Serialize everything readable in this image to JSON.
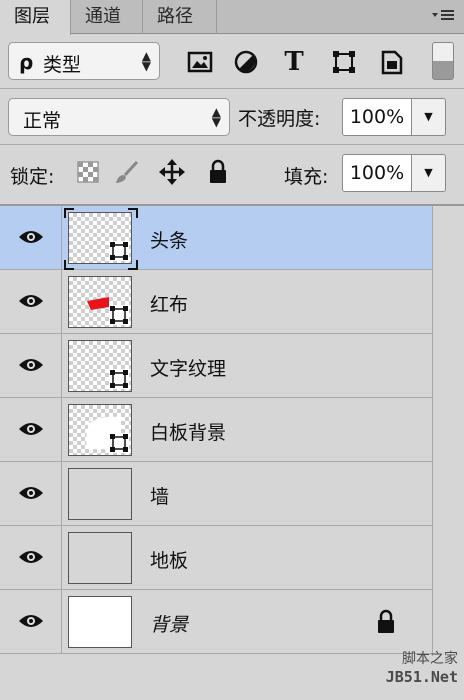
{
  "tabs": [
    {
      "label": "图层",
      "active": true
    },
    {
      "label": "通道",
      "active": false
    },
    {
      "label": "路径",
      "active": false
    }
  ],
  "panel_menu_icon": "panel-menu-icon",
  "filter": {
    "search_glyph": "ρ",
    "label": "类型",
    "icons": [
      "image-filter-icon",
      "adjustment-filter-icon",
      "type-filter-icon",
      "shape-filter-icon",
      "smart-object-filter-icon"
    ],
    "type_glyph": "T"
  },
  "blend": {
    "mode": "正常",
    "opacity_label": "不透明度:",
    "opacity_value": "100%"
  },
  "lock": {
    "label": "锁定:",
    "icons": [
      "lock-transparent-icon",
      "lock-image-icon",
      "lock-position-icon",
      "lock-all-icon"
    ],
    "fill_label": "填充:",
    "fill_value": "100%"
  },
  "layers": [
    {
      "name": "头条",
      "type": "shape",
      "selected": true
    },
    {
      "name": "红布",
      "type": "shape",
      "selected": false
    },
    {
      "name": "文字纹理",
      "type": "shape",
      "selected": false
    },
    {
      "name": "白板背景",
      "type": "shape",
      "selected": false
    },
    {
      "name": "墙",
      "type": "pixel",
      "selected": false
    },
    {
      "name": "地板",
      "type": "pixel",
      "selected": false
    },
    {
      "name": "背景",
      "type": "background",
      "selected": false,
      "locked": true
    }
  ],
  "watermark": {
    "line1": "脚本之家",
    "line2": "JB51.Net"
  },
  "colors": {
    "selection": "#b5cdf0",
    "panel": "#d6d6d6",
    "red_swatch": "#e8141b"
  }
}
